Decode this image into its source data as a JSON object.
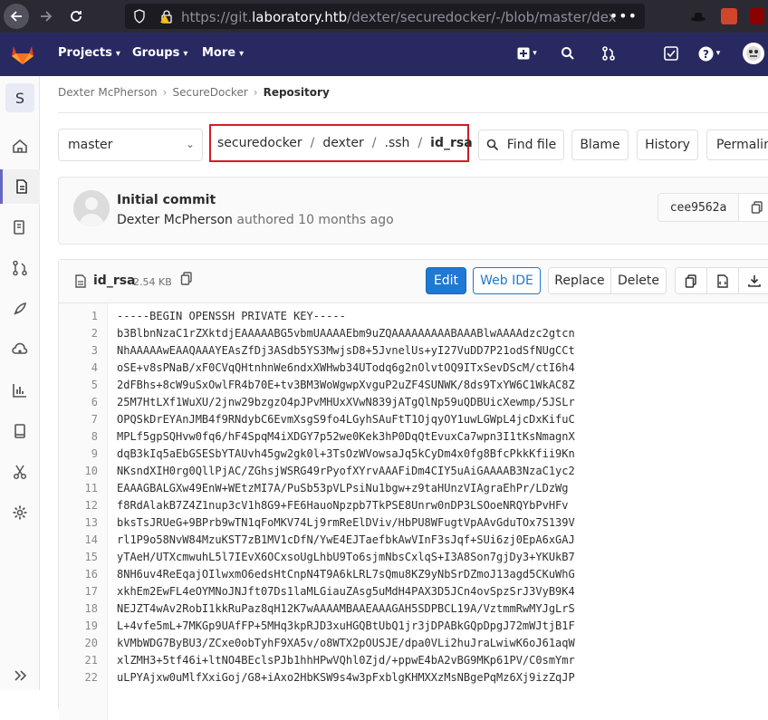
{
  "browser": {
    "url_prefix": "https://git.",
    "url_domain": "laboratory.htb",
    "url_rest": "/dexter/securedocker/-/blob/master/dexter/.s",
    "more": "•••"
  },
  "header": {
    "nav": [
      "Projects",
      "Groups",
      "More"
    ]
  },
  "sidebar": {
    "project_initial": "S"
  },
  "breadcrumb": {
    "items": [
      "Dexter McPherson",
      "SecureDocker",
      "Repository"
    ]
  },
  "branch": "master",
  "path": [
    "securedocker",
    "dexter",
    ".ssh",
    "id_rsa"
  ],
  "actions": {
    "find_file": "Find file",
    "blame": "Blame",
    "history": "History",
    "permalink": "Permalink"
  },
  "commit": {
    "title": "Initial commit",
    "author": "Dexter McPherson",
    "meta": "authored 10 months ago",
    "sha": "cee9562a"
  },
  "file": {
    "name": "id_rsa",
    "size": "2.54 KB",
    "edit": "Edit",
    "web_ide": "Web IDE",
    "replace": "Replace",
    "delete": "Delete"
  },
  "code_lines": [
    "-----BEGIN OPENSSH PRIVATE KEY-----",
    "b3BlbnNzaC1rZXktdjEAAAAABG5vbmUAAAAEbm9uZQAAAAAAAAABAAABlwAAAAdzc2gtcn",
    "NhAAAAAwEAAQAAAYEAsZfDj3ASdb5YS3MwjsD8+5JvnelUs+yI27VuDD7P21odSfNUgCCt",
    "oSE+v8sPNaB/xF0CVqQHtnhnWe6ndxXWHwb34UTodq6g2nOlvtOQ9ITxSevDScM/ctI6h4",
    "2dFBhs+8cW9uSxOwlFR4b70E+tv3BM3WoWgwpXvguP2uZF4SUNWK/8ds9TxYW6C1WkAC8Z",
    "25M7HtLXf1WuXU/2jnw29bzgzO4pJPvMHUxXVwN839jATgQlNp59uQDBUicXewmp/5JSLr",
    "OPQSkDrEYAnJMB4f9RNdybC6EvmXsgS9fo4LGyhSAuFtT1OjqyOY1uwLGWpL4jcDxKifuC",
    "MPLf5gpSQHvw0fq6/hF4SpqM4iXDGY7p52we0Kek3hP0DqQtEvuxCa7wpn3I1tKsNmagnX",
    "dqB3kIq5aEbGSESbYTAUvh45gw2gk0l+3TsOzWVowsaJq5kCyDm4x0fg8BfcPkkKfii9Kn",
    "NKsndXIH0rg0QllPjAC/ZGhsjWSRG49rPyofXYrvAAAFiDm4CIY5uAiGAAAAB3NzaC1yc2",
    "EAAAGBALGXw49EnW+WEtzMI7A/PuSb53pVLPsiNu1bgw+z9taHUnzVIAgraEhPr/LDzWg",
    "f8RdAlakB7Z4Z1nup3cV1h8G9+FE6HauoNpzpb7TkPSE8Unrw0nDP3LSOoeNRQYbPvHFv",
    "bksTsJRUeG+9BPrb9wTN1qFoMKV74Lj9rmReElDViv/HbPU8WFugtVpAAvGduTOx7S139V",
    "rl1P9o58NvW84MzuKST7zB1MV1cDfN/YwE4EJTaefbkAwVInF3sJqf+SUi6zj0EpA6xGAJ",
    "yTAeH/UTXcmwuhL5l7IEvX6OCxsoUgLhbU9To6sjmNbsCxlqS+I3A8Son7gjDy3+YKUkB7",
    "8NH6uv4ReEqajOIlwxmO6edsHtCnpN4T9A6kLRL7sQmu8KZ9yNbSrDZmoJ13agd5CKuWhG",
    "xkhEm2EwFL4eOYMNoJNJft07Ds1laMLGiauZAsg5uMdH4PAX3D5JCn4ovSpzSrJ3VyB9K4",
    "NEJZT4wAv2RobI1kkRuPaz8qH12K7wAAAAMBAAEAAAGAH5SDPBCL19A/VztmmRwMYJgLrS",
    "L+4vfe5mL+7MKGp9UAfFP+5MHq3kpRJD3xuHGQBtUbQ1jr3jDPABkGQpDpgJ72mWJtjB1F",
    "kVMbWDG7ByBU3/ZCxe0obTyhF9XA5v/o8WTX2pOUSJE/dpa0VLi2huJraLwiwK6oJ61aqW",
    "xlZMH3+5tf46i+ltNO4BEclsPJb1hhHPwVQhl0Zjd/+ppwE4bA2vBG9MKp61PV/C0smYmr",
    "uLPYAjxw0uMlfXxiGoj/G8+iAxo2HbKSW9s4w3pFxblgKHMXXzMsNBgePqMz6Xj9izZqJP"
  ]
}
